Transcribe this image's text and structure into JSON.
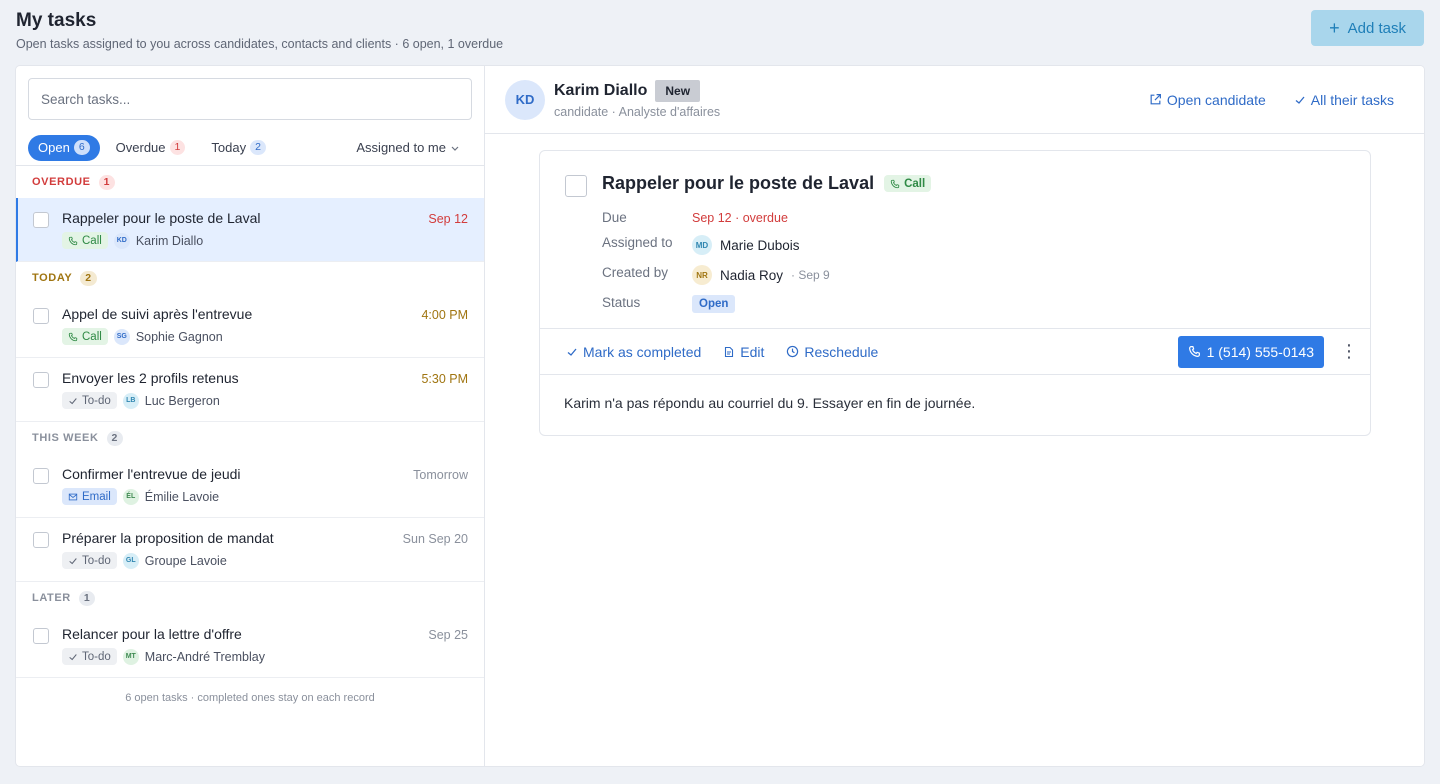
{
  "header": {
    "title": "My tasks",
    "subtitle": "Open tasks assigned to you across candidates, contacts and clients · 6 open, 1 overdue",
    "add_label": "Add task",
    "add_icon": "+"
  },
  "search": {
    "placeholder": "Search tasks..."
  },
  "filters": {
    "open": {
      "label": "Open",
      "count": "6"
    },
    "overdue": {
      "label": "Overdue",
      "count": "1"
    },
    "today": {
      "label": "Today",
      "count": "2"
    },
    "assigned": "Assigned to me"
  },
  "sections": {
    "overdue": {
      "label": "OVERDUE",
      "count": "1"
    },
    "today": {
      "label": "TODAY",
      "count": "2"
    },
    "week": {
      "label": "THIS WEEK",
      "count": "2"
    },
    "later": {
      "label": "LATER",
      "count": "1"
    }
  },
  "tasks": [
    {
      "title": "Rappeler pour le poste de Laval",
      "when": "Sep 12",
      "type": "Call",
      "initials": "KD",
      "person": "Karim Diallo"
    },
    {
      "title": "Appel de suivi après l'entrevue",
      "when": "4:00 PM",
      "type": "Call",
      "initials": "SG",
      "person": "Sophie Gagnon"
    },
    {
      "title": "Envoyer les 2 profils retenus",
      "when": "5:30 PM",
      "type": "To-do",
      "initials": "LB",
      "person": "Luc Bergeron"
    },
    {
      "title": "Confirmer l'entrevue de jeudi",
      "when": "Tomorrow",
      "type": "Email",
      "initials": "ÉL",
      "person": "Émilie Lavoie"
    },
    {
      "title": "Préparer la proposition de mandat",
      "when": "Sun Sep 20",
      "type": "To-do",
      "initials": "GL",
      "person": "Groupe Lavoie"
    },
    {
      "title": "Relancer pour la lettre d'offre",
      "when": "Sep 25",
      "type": "To-do",
      "initials": "MT",
      "person": "Marc-André Tremblay"
    }
  ],
  "footer_note": "6 open tasks · completed ones stay on each record",
  "record": {
    "initials": "KD",
    "name": "Karim Diallo",
    "badge": "New",
    "subtitle": "candidate · Analyste d'affaires",
    "open_link": "Open candidate",
    "all_link": "All their tasks"
  },
  "detail": {
    "title": "Rappeler pour le poste de Laval",
    "type": "Call",
    "due_label": "Due",
    "due_value": "Sep 12 · overdue",
    "assigned_label": "Assigned to",
    "assigned_initials": "MD",
    "assigned_name": "Marie Dubois",
    "created_label": "Created by",
    "created_initials": "NR",
    "created_name": "Nadia Roy",
    "created_date": "· Sep 9",
    "status_label": "Status",
    "status_value": "Open",
    "mark_label": "Mark as completed",
    "edit_label": "Edit",
    "reschedule_label": "Reschedule",
    "phone": "1 (514) 555-0143",
    "more_icon": "⋮",
    "note": "Karim n'a pas répondu au courriel du 9. Essayer en fin de journée."
  },
  "colors": {
    "accent": "#2f7ae5",
    "overdue": "#d23c3c",
    "today": "#a07511",
    "call": "#2f8a45"
  }
}
